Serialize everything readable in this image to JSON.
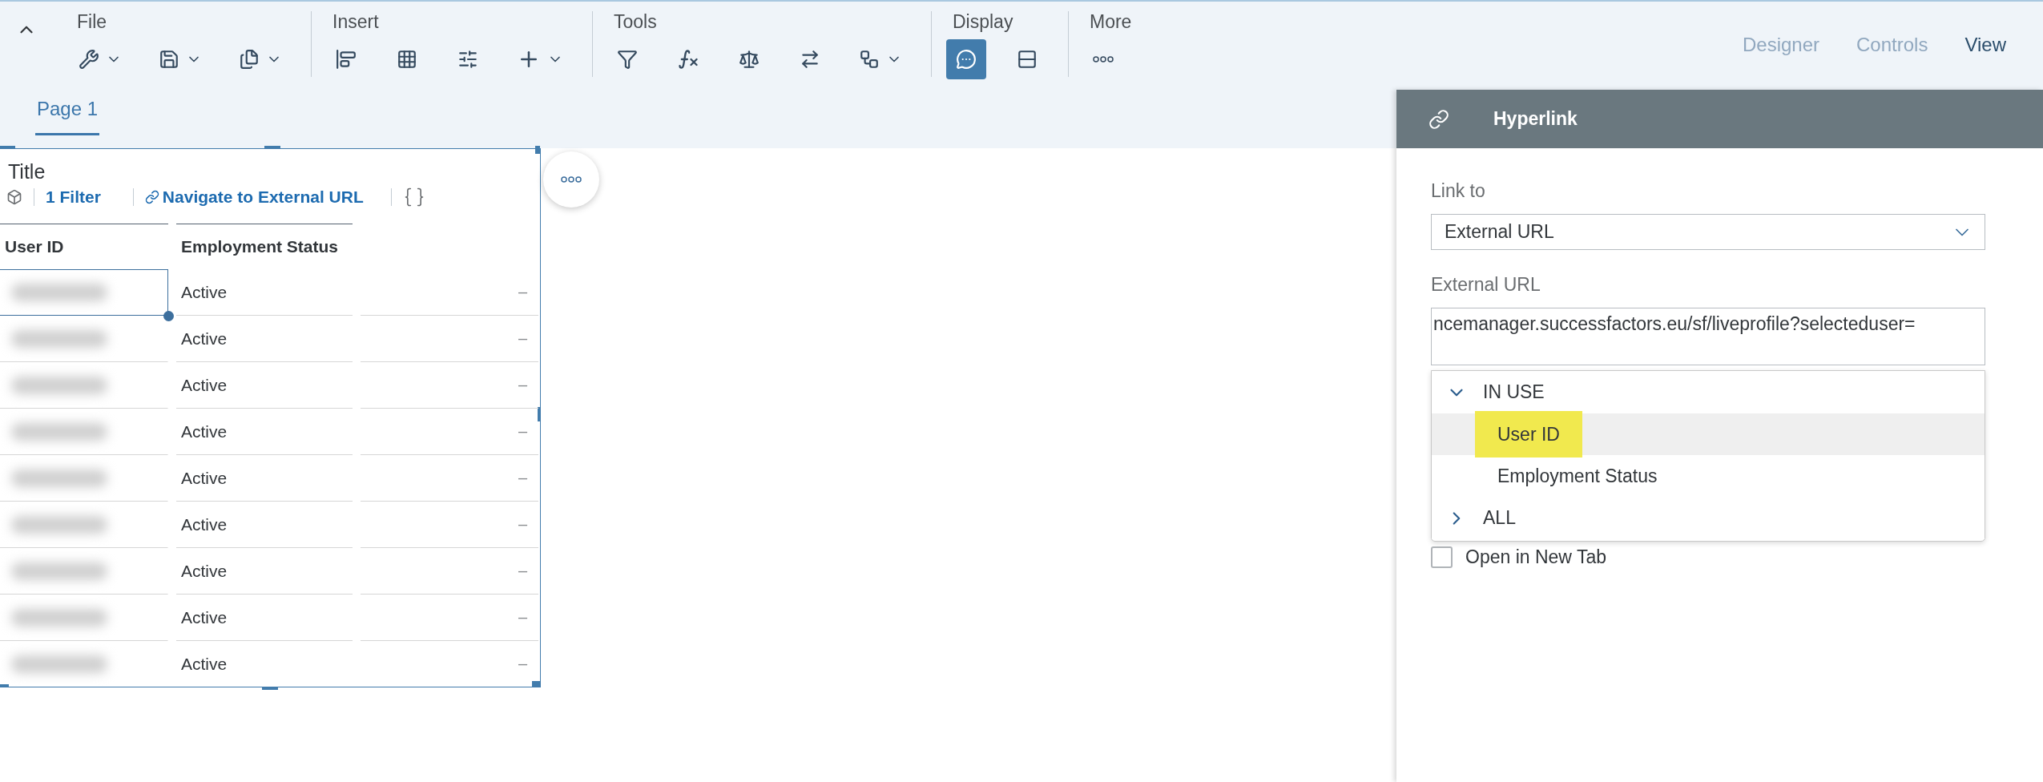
{
  "toolbar": {
    "groups": [
      {
        "label": "File"
      },
      {
        "label": "Insert"
      },
      {
        "label": "Tools"
      },
      {
        "label": "Display",
        "toggles": [
          {
            "selected": true
          },
          {
            "selected": false
          }
        ]
      },
      {
        "label": "More"
      }
    ],
    "mode_tabs": [
      {
        "label": "Designer",
        "selected": false
      },
      {
        "label": "Controls",
        "selected": false
      },
      {
        "label": "View",
        "selected": true
      }
    ]
  },
  "page_tabs": [
    {
      "label": "Page 1",
      "selected": true
    }
  ],
  "table_widget": {
    "title": "Title",
    "filter": "1 Filter",
    "link": "Navigate to External URL",
    "columns": [
      "User ID",
      "Employment Status"
    ],
    "rows": [
      {
        "employment_status": "Active",
        "column_3": "–",
        "selected": true
      },
      {
        "employment_status": "Active",
        "column_3": "–",
        "selected": false
      },
      {
        "employment_status": "Active",
        "column_3": "–",
        "selected": false
      },
      {
        "employment_status": "Active",
        "column_3": "–",
        "selected": false
      },
      {
        "employment_status": "Active",
        "column_3": "–",
        "selected": false
      },
      {
        "employment_status": "Active",
        "column_3": "–",
        "selected": false
      },
      {
        "employment_status": "Active",
        "column_3": "–",
        "selected": false
      },
      {
        "employment_status": "Active",
        "column_3": "–",
        "selected": false
      },
      {
        "employment_status": "Active",
        "column_3": "–",
        "selected": false
      }
    ]
  },
  "panel": {
    "title": "Hyperlink",
    "link_to_label": "Link to",
    "link_to_value": "External URL",
    "url_label": "External URL",
    "url_value": "ncemanager.successfactors.eu/sf/liveprofile?selecteduser=",
    "dropdown": {
      "groups": [
        {
          "label": "IN USE",
          "expanded": true,
          "children": [
            {
              "label": "User ID",
              "selected": true,
              "highlighted": true
            },
            {
              "label": "Employment Status",
              "selected": false,
              "highlighted": false
            }
          ]
        },
        {
          "label": "ALL",
          "expanded": false
        }
      ]
    },
    "open_in_new_tab": {
      "label": "Open in New Tab",
      "checked": false
    }
  }
}
